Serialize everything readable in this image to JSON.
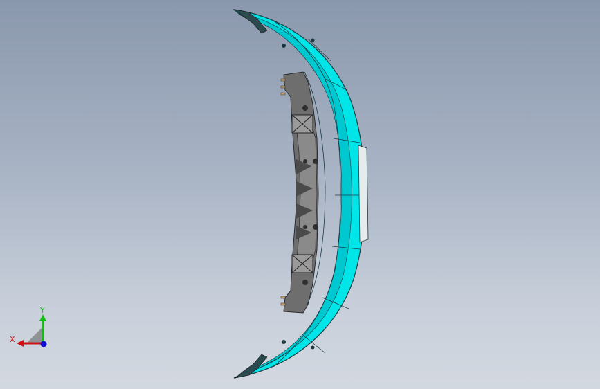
{
  "viewport": {
    "background_top": "#8a98ad",
    "background_bottom": "#d3d8e0"
  },
  "model": {
    "bumper_color": "#00e6e8",
    "bumper_shade": "#00c8d0",
    "edge_color": "#1a3a40",
    "bracket_color": "#6e6e6e",
    "bracket_dark": "#3c3c3c",
    "bracket_light": "#9a9a9a",
    "insert_color": "#e6ecec"
  },
  "triad": {
    "x_label": "X",
    "y_label": "Y",
    "x_color": "#d01010",
    "y_color": "#10c010",
    "z_color": "#1010d8",
    "plane_color": "#8c8c8c",
    "icon": "coordinate-triad-icon"
  }
}
